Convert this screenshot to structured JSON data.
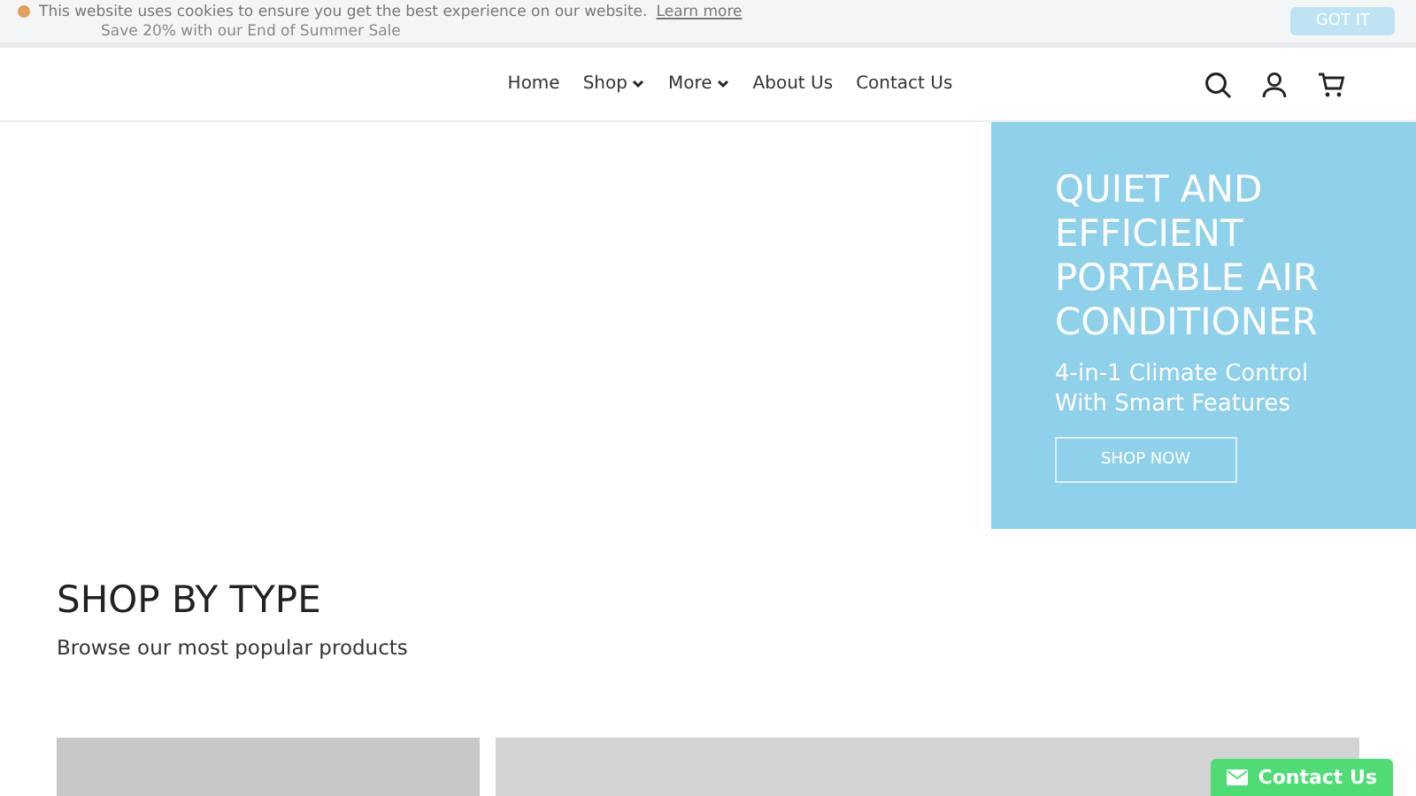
{
  "cookie_bar": {
    "message": "This website uses cookies to ensure you get the best experience on our website.",
    "link": "Learn more",
    "button": "GOT IT",
    "promo": "Save 20% with our End of Summer Sale"
  },
  "nav": {
    "items": [
      {
        "label": "Home",
        "dropdown": false
      },
      {
        "label": "Shop",
        "dropdown": true
      },
      {
        "label": "More",
        "dropdown": true
      },
      {
        "label": "About Us",
        "dropdown": false
      },
      {
        "label": "Contact Us",
        "dropdown": false
      }
    ]
  },
  "hero": {
    "title": "QUIET AND EFFICIENT PORTABLE AIR CONDITIONER",
    "subtitle": "4-in-1 Climate Control With Smart Features",
    "button": "SHOP NOW"
  },
  "section": {
    "title": "SHOP BY TYPE",
    "subtitle": "Browse our most popular products"
  },
  "contact_widget": {
    "label": "Contact Us"
  }
}
